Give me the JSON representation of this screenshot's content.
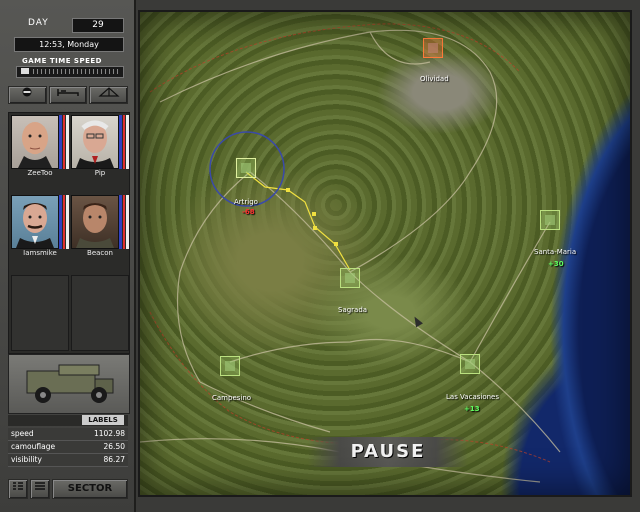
{
  "panel": {
    "day_label": "DAY",
    "day_value": "29",
    "time_value": "12:53, Monday",
    "speed_label": "GAME TIME SPEED",
    "tool_buttons": [
      "stop-icon",
      "bed-icon",
      "tent-icon"
    ],
    "mercs": [
      {
        "name": "ZeeToo",
        "bars": [
          "#3040c0",
          "#e03030",
          "#f0f0f0"
        ]
      },
      {
        "name": "Pip",
        "bars": [
          "#3040c0",
          "#e03030",
          "#f0f0f0"
        ]
      },
      {
        "name": "Iamsmike",
        "bars": [
          "#3040c0",
          "#e03030",
          "#f0f0f0"
        ]
      },
      {
        "name": "Beacon",
        "bars": [
          "#3040c0",
          "#e03030",
          "#f0f0f0"
        ]
      }
    ],
    "labels_button": "LABELS",
    "stats": [
      {
        "label": "speed",
        "value": "1102.98"
      },
      {
        "label": "camouflage",
        "value": "26.50"
      },
      {
        "label": "visibility",
        "value": "86.27"
      }
    ],
    "sector_button": "SECTOR"
  },
  "map": {
    "cities": [
      {
        "name": "Olividad",
        "status": "hostile",
        "modifier": ""
      },
      {
        "name": "Artrigo",
        "status": "player",
        "modifier": "-68"
      },
      {
        "name": "Santa-Maria",
        "status": "friendly",
        "modifier": "+30"
      },
      {
        "name": "Sagrada",
        "status": "friendly",
        "modifier": ""
      },
      {
        "name": "Campesino",
        "status": "friendly",
        "modifier": ""
      },
      {
        "name": "Las Vacasiones",
        "status": "friendly",
        "modifier": "+13"
      }
    ],
    "pause_text": "PAUSE"
  },
  "colors": {
    "friendly": "#bbe080",
    "hostile": "#ff7b3a",
    "route": "#f0e040",
    "positive_mod": "#60ff60",
    "negative_mod": "#ff3030"
  }
}
